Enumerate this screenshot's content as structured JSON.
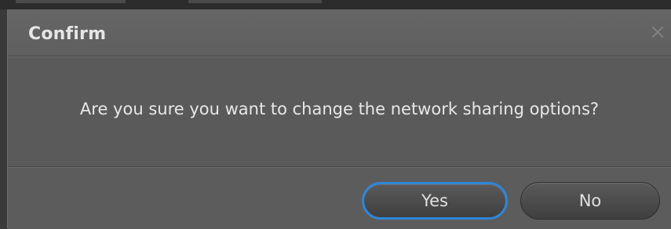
{
  "dialog": {
    "title": "Confirm",
    "close_icon": "close-icon",
    "message": "Are you sure you want to change the network sharing options?",
    "buttons": {
      "yes_label": "Yes",
      "no_label": "No"
    },
    "focused_button": "Yes",
    "focus_color": "#2f86d8"
  }
}
